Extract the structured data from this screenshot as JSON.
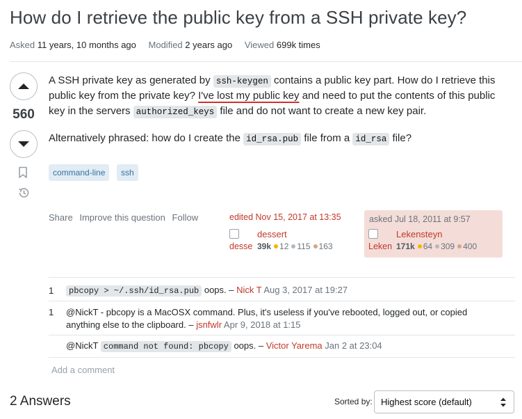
{
  "question": {
    "title": "How do I retrieve the public key from a SSH private key?",
    "meta": {
      "asked_label": "Asked",
      "asked_value": "11 years, 10 months ago",
      "modified_label": "Modified",
      "modified_value": "2 years ago",
      "viewed_label": "Viewed",
      "viewed_value": "699k times"
    },
    "score": "560",
    "body": {
      "p1_a": "A SSH private key as generated by ",
      "p1_code1": "ssh-keygen",
      "p1_b": " contains a public key part. How do I retrieve this",
      "p1_line2_a": "public key from the private key? ",
      "p1_line2_underlined": "I've lost my public key",
      "p1_line2_b": " and need to put the contents of this public",
      "p1_line3_a": "key in the servers ",
      "p1_code2": "authorized_keys",
      "p1_line3_b": " file and do not want to create a new key pair.",
      "p2_a": "Alternatively phrased: how do I create the ",
      "p2_code1": "id_rsa.pub",
      "p2_b": " file from a ",
      "p2_code2": "id_rsa",
      "p2_c": " file?"
    },
    "tags": [
      "command-line",
      "ssh"
    ],
    "actions": {
      "share": "Share",
      "improve": "Improve this question",
      "follow": "Follow"
    },
    "edited": {
      "when": "edited Nov 15, 2017 at 13:35",
      "avatar_alt": "desse",
      "user": "dessert",
      "rep": "39k",
      "gold": "12",
      "silver": "115",
      "bronze": "163"
    },
    "asked": {
      "when": "asked Jul 18, 2011 at 9:57",
      "avatar_alt": "Leken",
      "user": "Lekensteyn",
      "rep": "171k",
      "gold": "64",
      "silver": "309",
      "bronze": "400"
    }
  },
  "comments": [
    {
      "score": "1",
      "code": "pbcopy > ~/.ssh/id_rsa.pub",
      "text": " oops. – ",
      "user": "Nick T",
      "date": " Aug 3, 2017 at 19:27"
    },
    {
      "score": "1",
      "line1": "@NickT - pbcopy is a MacOSX command. Plus, it's useless if you've rebooted, logged out, or copied",
      "line2": "anything else to the clipboard. – ",
      "user": "jsnfwlr",
      "date": " Apr 9, 2018 at 1:15"
    },
    {
      "score": "",
      "prefix": "@NickT ",
      "code": "command not found: pbcopy",
      "text": " oops. – ",
      "user": "Victor Yarema",
      "date": " Jan 2 at 23:04"
    }
  ],
  "add_comment": "Add a comment",
  "answers": {
    "count_label": "2 Answers",
    "sorted_by_label": "Sorted by:",
    "sort_value": "Highest score (default)"
  },
  "colors": {
    "link_red": "#c0392b",
    "tag_bg": "#e1ecf4",
    "tag_fg": "#39739d",
    "asked_card_bg": "#f4ddd8",
    "gold": "#f1b600",
    "silver": "#b4b8bc",
    "bronze": "#d1a684"
  },
  "icons": [
    "upvote-arrow-icon",
    "downvote-arrow-icon",
    "bookmark-icon",
    "history-icon",
    "sort-arrows-icon",
    "broken-image-icon"
  ]
}
